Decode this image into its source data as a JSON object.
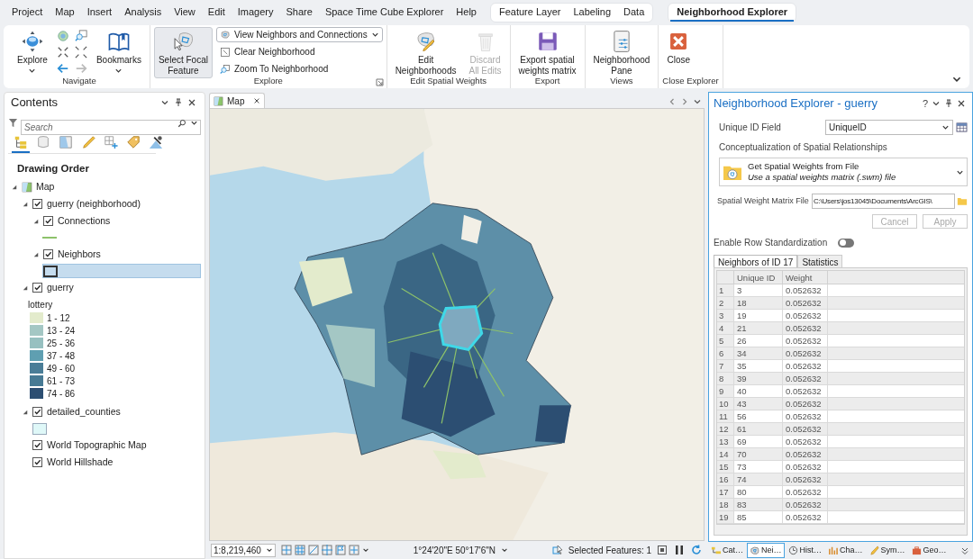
{
  "tabs": [
    {
      "label": "Project",
      "kind": "main",
      "selected": false
    },
    {
      "label": "Map",
      "kind": "main",
      "selected": false
    },
    {
      "label": "Insert",
      "kind": "main",
      "selected": false
    },
    {
      "label": "Analysis",
      "kind": "main",
      "selected": false
    },
    {
      "label": "View",
      "kind": "main",
      "selected": false
    },
    {
      "label": "Edit",
      "kind": "main",
      "selected": false
    },
    {
      "label": "Imagery",
      "kind": "main",
      "selected": false
    },
    {
      "label": "Share",
      "kind": "main",
      "selected": false
    },
    {
      "label": "Space Time Cube Explorer",
      "kind": "main",
      "selected": false
    },
    {
      "label": "Help",
      "kind": "main",
      "selected": false
    },
    {
      "label": "Feature Layer",
      "kind": "layer",
      "selected": false
    },
    {
      "label": "Labeling",
      "kind": "layer",
      "selected": false
    },
    {
      "label": "Data",
      "kind": "layer",
      "selected": false
    },
    {
      "label": "Neighborhood Explorer",
      "kind": "explorer",
      "selected": true
    }
  ],
  "ribbon": {
    "groups": [
      {
        "label": "Navigate",
        "launcher": false,
        "controls": [
          {
            "kind": "large",
            "label": "Explore",
            "dropdown": true,
            "selected": false,
            "disabled": false
          },
          {
            "kind": "tools"
          },
          {
            "kind": "large",
            "label": "Bookmarks",
            "dropdown": true,
            "selected": false,
            "disabled": false
          }
        ]
      },
      {
        "label": "Explore",
        "launcher": true,
        "controls": [
          {
            "kind": "large",
            "label": "Select Focal\nFeature",
            "dropdown": false,
            "selected": true,
            "disabled": false
          },
          {
            "kind": "small",
            "label": "View Neighbors and Connections",
            "dropdown": true
          },
          {
            "kind": "small",
            "label": "Clear Neighborhood",
            "dropdown": false
          },
          {
            "kind": "small",
            "label": "Zoom To Neighborhood",
            "dropdown": false
          }
        ]
      },
      {
        "label": "Edit Spatial Weights",
        "launcher": false,
        "controls": [
          {
            "kind": "large",
            "label": "Edit\nNeighborhoods",
            "dropdown": false,
            "selected": false,
            "disabled": false
          },
          {
            "kind": "large",
            "label": "Discard\nAll Edits",
            "dropdown": false,
            "selected": false,
            "disabled": true
          }
        ]
      },
      {
        "label": "Export",
        "launcher": false,
        "controls": [
          {
            "kind": "large",
            "label": "Export spatial\nweights matrix",
            "dropdown": false,
            "selected": false,
            "disabled": false
          }
        ]
      },
      {
        "label": "Views",
        "launcher": false,
        "controls": [
          {
            "kind": "large",
            "label": "Neighborhood\nPane",
            "dropdown": false,
            "selected": false,
            "disabled": false
          }
        ]
      },
      {
        "label": "Close Explorer",
        "launcher": false,
        "controls": [
          {
            "kind": "large",
            "label": "Close",
            "dropdown": false,
            "selected": false,
            "disabled": false
          }
        ]
      }
    ]
  },
  "contents": {
    "title": "Contents",
    "search": {
      "placeholder": "Search"
    },
    "view_tabs": [
      {
        "selected": true
      },
      {
        "selected": false
      },
      {
        "selected": false
      },
      {
        "selected": false
      },
      {
        "selected": false
      },
      {
        "selected": false
      },
      {
        "selected": false
      }
    ],
    "heading": "Drawing Order",
    "map_node": {
      "label": "Map",
      "expanded": true,
      "children": [
        {
          "label": "guerry (neighborhood)",
          "kind": "layer",
          "checked": true,
          "expanded": true,
          "children": [
            {
              "label": "Connections",
              "kind": "layer",
              "checked": true,
              "expanded": true,
              "symbol": {
                "kind": "line",
                "color": "#8dc26a",
                "selected": false
              }
            },
            {
              "label": "Neighbors",
              "kind": "layer",
              "checked": true,
              "expanded": true,
              "symbol": {
                "kind": "fill",
                "color": "#c5dcee",
                "selected": true
              }
            }
          ]
        },
        {
          "label": "guerry",
          "kind": "layer",
          "checked": true,
          "expanded": true,
          "legend": {
            "field": "lottery",
            "classes": [
              {
                "label": "1 - 12",
                "color": "#e3ebcc"
              },
              {
                "label": "13 - 24",
                "color": "#a4c7c4"
              },
              {
                "label": "25 - 36",
                "color": "#97c0c0"
              },
              {
                "label": "37 - 48",
                "color": "#5f9fb1"
              },
              {
                "label": "49 - 60",
                "color": "#4a7d97"
              },
              {
                "label": "61 - 73",
                "color": "#477a94"
              },
              {
                "label": "74 - 86",
                "color": "#2c4e72"
              }
            ]
          }
        },
        {
          "label": "detailed_counties",
          "kind": "layer",
          "checked": true,
          "expanded": true,
          "symbol": {
            "kind": "fill",
            "color": "#dff8f8",
            "selected": false
          }
        },
        {
          "label": "World Topographic Map",
          "kind": "basemap",
          "checked": true
        },
        {
          "label": "World Hillshade",
          "kind": "basemap",
          "checked": true
        }
      ]
    }
  },
  "map_view": {
    "tab": "Map",
    "kind": "picture",
    "status_bar": {
      "scale": "1:8,219,460",
      "coordinates": "1°24'20\"E 50°17'6\"N",
      "selection": "Selected Features: 1"
    }
  },
  "neighborhood_pane": {
    "title": "Neighborhood Explorer - guerry",
    "help": "?",
    "unique_id_field": {
      "label": "Unique ID Field",
      "value": "UniqueID"
    },
    "conceptualization": {
      "label": "Conceptualization of Spatial Relationships",
      "value": "Get Spatial Weights from File",
      "description": "Use a spatial weights matrix (.swm) file"
    },
    "matrix_file": {
      "label": "Spatial Weight Matrix File",
      "value": "C:\\Users\\jos13045\\Documents\\ArcGIS\\"
    },
    "buttons": [
      {
        "label": "Cancel",
        "disabled": true
      },
      {
        "label": "Apply",
        "disabled": true
      }
    ],
    "row_standardization": {
      "label": "Enable Row Standardization",
      "on": false
    },
    "tabs": [
      {
        "label": "Neighbors of ID 17",
        "selected": true
      },
      {
        "label": "Statistics",
        "selected": false
      }
    ],
    "table": {
      "columns": [
        "Unique ID",
        "Weight"
      ],
      "rows": [
        {
          "index": "1",
          "unique_id": "3",
          "weight": "0.052632"
        },
        {
          "index": "2",
          "unique_id": "18",
          "weight": "0.052632"
        },
        {
          "index": "3",
          "unique_id": "19",
          "weight": "0.052632"
        },
        {
          "index": "4",
          "unique_id": "21",
          "weight": "0.052632"
        },
        {
          "index": "5",
          "unique_id": "26",
          "weight": "0.052632"
        },
        {
          "index": "6",
          "unique_id": "34",
          "weight": "0.052632"
        },
        {
          "index": "7",
          "unique_id": "35",
          "weight": "0.052632"
        },
        {
          "index": "8",
          "unique_id": "39",
          "weight": "0.052632"
        },
        {
          "index": "9",
          "unique_id": "40",
          "weight": "0.052632"
        },
        {
          "index": "10",
          "unique_id": "43",
          "weight": "0.052632"
        },
        {
          "index": "11",
          "unique_id": "56",
          "weight": "0.052632"
        },
        {
          "index": "12",
          "unique_id": "61",
          "weight": "0.052632"
        },
        {
          "index": "13",
          "unique_id": "69",
          "weight": "0.052632"
        },
        {
          "index": "14",
          "unique_id": "70",
          "weight": "0.052632"
        },
        {
          "index": "15",
          "unique_id": "73",
          "weight": "0.052632"
        },
        {
          "index": "16",
          "unique_id": "74",
          "weight": "0.052632"
        },
        {
          "index": "17",
          "unique_id": "80",
          "weight": "0.052632"
        },
        {
          "index": "18",
          "unique_id": "83",
          "weight": "0.052632"
        },
        {
          "index": "19",
          "unique_id": "85",
          "weight": "0.052632"
        }
      ]
    }
  },
  "dock_tabs": [
    {
      "label": "Cat…",
      "selected": false
    },
    {
      "label": "Nei…",
      "selected": true
    },
    {
      "label": "Hist…",
      "selected": false
    },
    {
      "label": "Cha…",
      "selected": false
    },
    {
      "label": "Sym…",
      "selected": false
    },
    {
      "label": "Geo…",
      "selected": false
    }
  ]
}
